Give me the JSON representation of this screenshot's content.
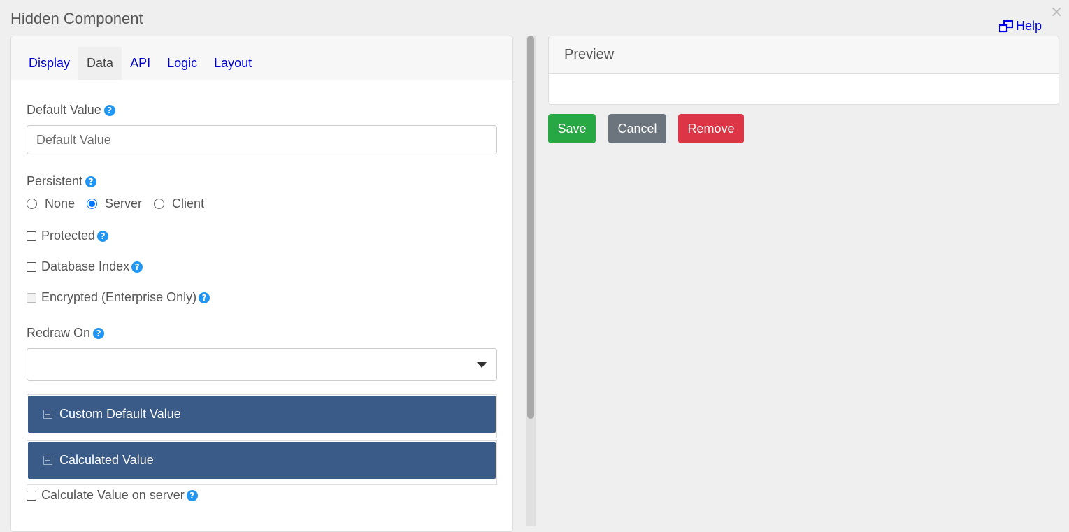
{
  "dialog": {
    "title": "Hidden Component",
    "close_glyph": "×",
    "help_label": "Help"
  },
  "tabs": [
    {
      "label": "Display",
      "active": false
    },
    {
      "label": "Data",
      "active": true
    },
    {
      "label": "API",
      "active": false
    },
    {
      "label": "Logic",
      "active": false
    },
    {
      "label": "Layout",
      "active": false
    }
  ],
  "form": {
    "default_value": {
      "label": "Default Value",
      "placeholder": "Default Value",
      "value": ""
    },
    "persistent": {
      "label": "Persistent",
      "options": [
        {
          "label": "None",
          "checked": false
        },
        {
          "label": "Server",
          "checked": true
        },
        {
          "label": "Client",
          "checked": false
        }
      ]
    },
    "protected": {
      "label": "Protected",
      "checked": false
    },
    "database_index": {
      "label": "Database Index",
      "checked": false
    },
    "encrypted": {
      "label": "Encrypted (Enterprise Only)",
      "checked": false,
      "disabled": true
    },
    "redraw_on": {
      "label": "Redraw On",
      "selected": ""
    },
    "custom_default_value": {
      "label": "Custom Default Value"
    },
    "calculated_value": {
      "label": "Calculated Value"
    },
    "calculate_on_server": {
      "label": "Calculate Value on server",
      "checked": false
    },
    "help_glyph": "?"
  },
  "preview": {
    "title": "Preview"
  },
  "actions": {
    "save": "Save",
    "cancel": "Cancel",
    "remove": "Remove"
  },
  "colors": {
    "accordion_header": "#3a5a88",
    "save": "#28a745",
    "cancel": "#6c757d",
    "remove": "#dc3545",
    "help_icon": "#2196f3",
    "link": "#0000ee"
  },
  "icons": {
    "help": "external-window-icon",
    "question": "question-circle-icon",
    "expand": "plus-square-icon",
    "dropdown": "caret-down-icon"
  }
}
